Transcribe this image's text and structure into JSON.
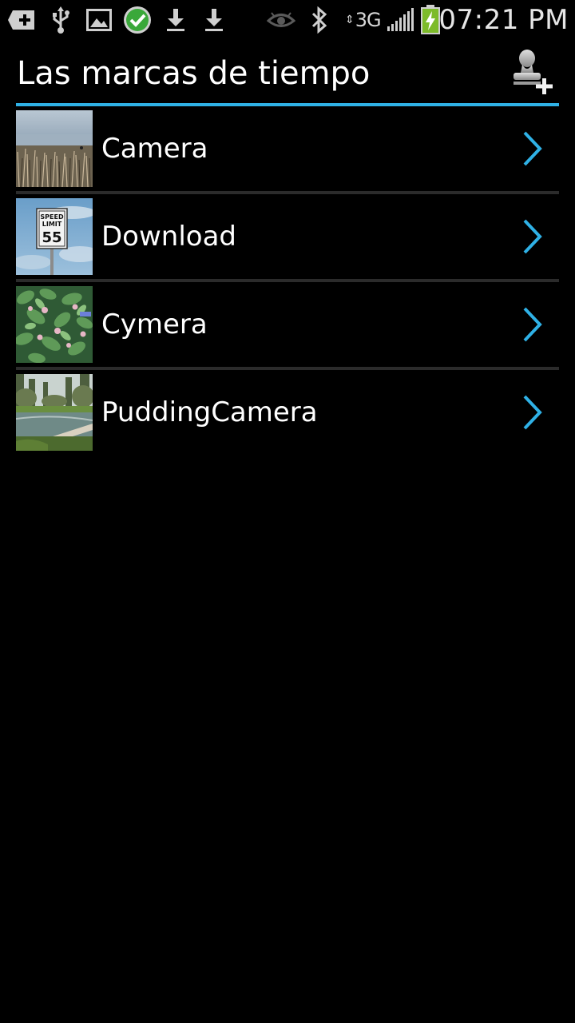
{
  "status_bar": {
    "time": "07:21 PM",
    "network": "3G",
    "icons": [
      "battery-plus-icon",
      "usb-icon",
      "image-icon",
      "check-circle-icon",
      "download-icon",
      "download-icon",
      "eye-icon",
      "bluetooth-icon",
      "signal-icon",
      "battery-charging-icon"
    ]
  },
  "header": {
    "title": "Las marcas de tiempo",
    "action_icon": "add-stamp-icon"
  },
  "folders": [
    {
      "label": "Camera",
      "thumbnail": "frosty-reeds"
    },
    {
      "label": "Download",
      "thumbnail": "speed-limit-sign"
    },
    {
      "label": "Cymera",
      "thumbnail": "flowering-shrub"
    },
    {
      "label": "PuddingCamera",
      "thumbnail": "forest-stream"
    }
  ],
  "thumbnail_text": {
    "sign_top": "SPEED",
    "sign_mid": "LIMIT",
    "sign_num": "55"
  },
  "colors": {
    "accent": "#2fb1e6",
    "background": "#000000",
    "divider": "#2b2b2b"
  }
}
